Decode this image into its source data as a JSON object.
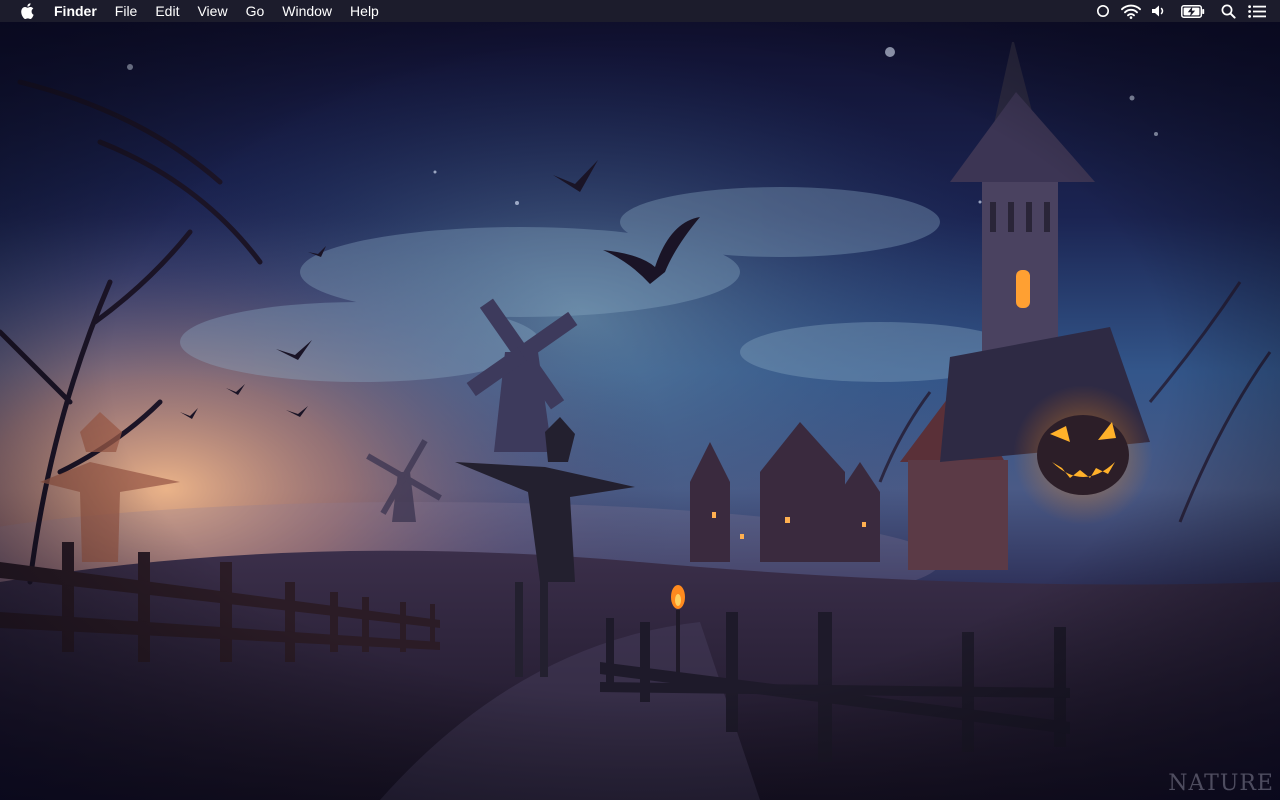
{
  "menubar": {
    "apple_icon": "apple-logo-icon",
    "app_name": "Finder",
    "items": [
      "File",
      "Edit",
      "View",
      "Go",
      "Window",
      "Help"
    ],
    "status_icons": [
      "siri-circle-icon",
      "wifi-icon",
      "volume-icon",
      "battery-charging-icon",
      "spotlight-search-icon",
      "notification-center-icon"
    ]
  },
  "desktop": {
    "wallpaper": "halloween-night-village",
    "watermark": "NATURE"
  },
  "colors": {
    "menubar_bg": "#1c1c2c",
    "sky_top": "#121236",
    "sky_mid": "#2c4a7a",
    "horizon_glow": "#e6a77a",
    "pumpkin": "#ff9a1e"
  }
}
